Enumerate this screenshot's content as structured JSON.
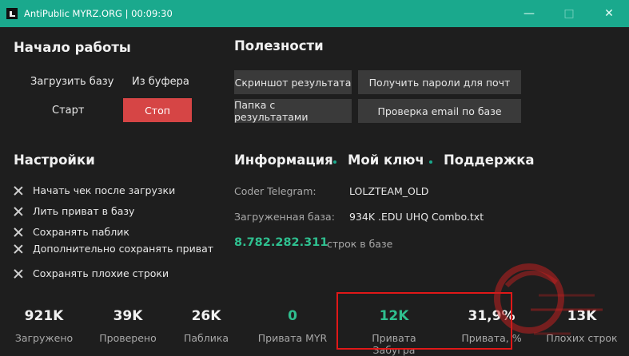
{
  "titlebar": {
    "title": "AntiPublic MYRZ.ORG | 00:09:30"
  },
  "start": {
    "heading": "Начало работы",
    "load_base": "Загрузить базу",
    "from_buffer": "Из буфера",
    "start": "Старт",
    "stop": "Стоп"
  },
  "utils": {
    "heading": "Полезности",
    "screenshot": "Скриншот результата",
    "get_passwords": "Получить пароли для почт",
    "results_folder": "Папка с результатами",
    "email_check": "Проверка email по базе"
  },
  "settings": {
    "heading": "Настройки",
    "items": [
      "Начать чек после загрузки",
      "Лить приват в базу",
      "Сохранять паблик",
      "Дополнительно сохранять приват",
      "Сохранять плохие строки"
    ]
  },
  "info": {
    "tab_info": "Информация",
    "tab_key": "Мой ключ",
    "tab_support": "Поддержка",
    "coder_label": "Coder Telegram:",
    "coder_value": "LOLZTEAM_OLD",
    "base_label": "Загруженная база:",
    "base_value": "934K .EDU UHQ Combo.txt",
    "lines_count": "8.782.282.311",
    "lines_label": "строк в базе"
  },
  "stats": [
    {
      "value": "921K",
      "label": "Загружено"
    },
    {
      "value": "39K",
      "label": "Проверено"
    },
    {
      "value": "26K",
      "label": "Паблика"
    },
    {
      "value": "0",
      "label": "Привата MYR"
    },
    {
      "value": "12K",
      "label": "Привата Забугра"
    },
    {
      "value": "31,9%",
      "label": "Привата, %"
    },
    {
      "value": "13K",
      "label": "Плохих строк"
    }
  ],
  "colors": {
    "accent": "#1aa98d",
    "stop": "#d64545",
    "green_text": "#2fbf8f",
    "highlight": "#e01818"
  }
}
